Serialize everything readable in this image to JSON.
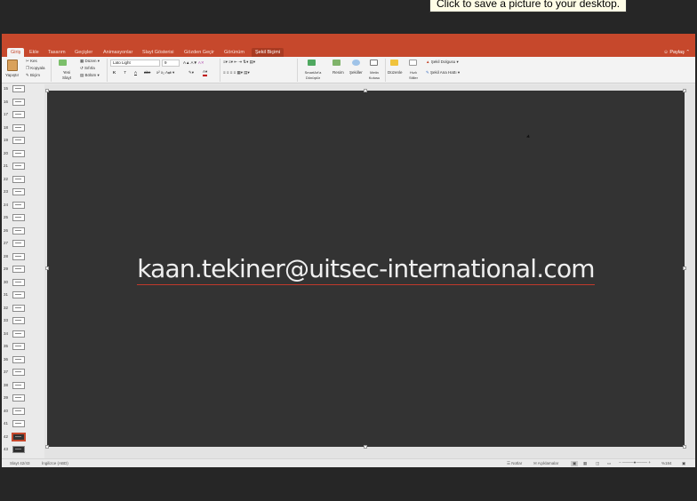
{
  "tooltip": {
    "text": "Click to save a picture to your desktop."
  },
  "ribbon": {
    "tabs": [
      {
        "label": "Giriş",
        "state": "active"
      },
      {
        "label": "Ekle",
        "state": "normal"
      },
      {
        "label": "Tasarım",
        "state": "normal"
      },
      {
        "label": "Geçişler",
        "state": "normal"
      },
      {
        "label": "Animasyonlar",
        "state": "normal"
      },
      {
        "label": "Slayt Gösterisi",
        "state": "normal"
      },
      {
        "label": "Gözden Geçir",
        "state": "normal"
      },
      {
        "label": "Görünüm",
        "state": "normal"
      },
      {
        "label": "Şekil Biçimi",
        "state": "contextual"
      }
    ],
    "share_label": "Paylaş",
    "clipboard": {
      "paste": "Yapıştır",
      "cut": "Kes",
      "copy": "Kopyala",
      "format": "Biçim"
    },
    "slides": {
      "new_slide": "Yeni Slayt",
      "layout": "Düzen",
      "reset": "Sıfırla",
      "section": "Bölüm"
    },
    "font": {
      "name": "Lato Light",
      "size": "9",
      "bold": "K",
      "italic": "T",
      "underline": "A",
      "strike": "abc"
    },
    "drawing": {
      "smartart": "SmartArt'a Dönüştür",
      "picture": "Resim",
      "shapes": "Şekiller",
      "textbox": "Metin Kutusu",
      "arrange": "Düzenle",
      "quick_styles": "Hızlı Stiller",
      "shape_fill": "Şekil Dolgusu",
      "shape_outline": "Şekil Ana Hattı"
    }
  },
  "thumbnails": [
    {
      "num": "15",
      "style": "light"
    },
    {
      "num": "16",
      "style": "light"
    },
    {
      "num": "17",
      "style": "light"
    },
    {
      "num": "18",
      "style": "light"
    },
    {
      "num": "19",
      "style": "light"
    },
    {
      "num": "20",
      "style": "light"
    },
    {
      "num": "21",
      "style": "light"
    },
    {
      "num": "22",
      "style": "light"
    },
    {
      "num": "23",
      "style": "light"
    },
    {
      "num": "24",
      "style": "light"
    },
    {
      "num": "25",
      "style": "light"
    },
    {
      "num": "26",
      "style": "light"
    },
    {
      "num": "27",
      "style": "light"
    },
    {
      "num": "28",
      "style": "light"
    },
    {
      "num": "29",
      "style": "light"
    },
    {
      "num": "30",
      "style": "light"
    },
    {
      "num": "31",
      "style": "light"
    },
    {
      "num": "32",
      "style": "light"
    },
    {
      "num": "33",
      "style": "light"
    },
    {
      "num": "34",
      "style": "light"
    },
    {
      "num": "35",
      "style": "light"
    },
    {
      "num": "36",
      "style": "light"
    },
    {
      "num": "37",
      "style": "light"
    },
    {
      "num": "38",
      "style": "light"
    },
    {
      "num": "39",
      "style": "light"
    },
    {
      "num": "40",
      "style": "light"
    },
    {
      "num": "41",
      "style": "light"
    },
    {
      "num": "42",
      "style": "selected"
    },
    {
      "num": "43",
      "style": "dark"
    }
  ],
  "slide": {
    "text": "kaan.tekiner@uitsec-international.com",
    "background": "#333333",
    "text_color": "#efefef"
  },
  "status": {
    "slide_info": "Slayt 42/43",
    "language": "İngilizce (ABD)",
    "notes": "Notlar",
    "comments": "Açıklamalar",
    "zoom": "%184"
  },
  "colors": {
    "accent": "#c6482c"
  }
}
